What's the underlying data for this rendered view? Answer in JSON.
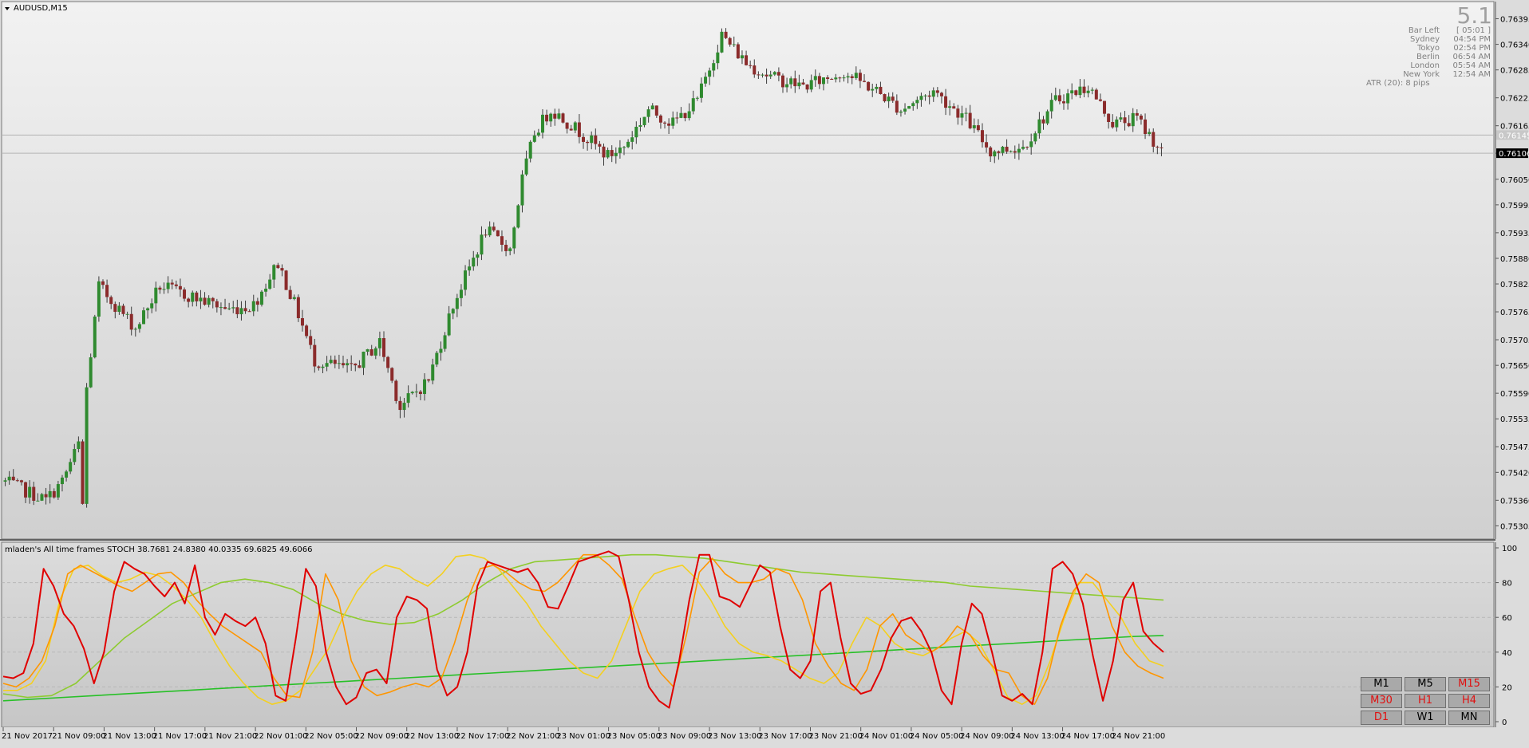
{
  "symbol_title": "AUDUSD,M15",
  "indicator_title": "mladen's  All time frames STOCH 38.7681 24.8380 40.0335 69.6825 49.6066",
  "info_panel": {
    "big_value": "5.1",
    "rows": [
      {
        "label": "Bar Left",
        "value": "[ 05:01 ]"
      },
      {
        "label": "Sydney",
        "value": "04:54 PM"
      },
      {
        "label": "Tokyo",
        "value": "02:54 PM"
      },
      {
        "label": "Berlin",
        "value": "06:54 AM"
      },
      {
        "label": "London",
        "value": "05:54 AM"
      },
      {
        "label": "New York",
        "value": "12:54 AM"
      }
    ],
    "atr": "ATR (20): 8 pips"
  },
  "timeframe_buttons": [
    {
      "label": "M1",
      "active": false
    },
    {
      "label": "M5",
      "active": false
    },
    {
      "label": "M15",
      "active": true
    },
    {
      "label": "M30",
      "active": true
    },
    {
      "label": "H1",
      "active": true
    },
    {
      "label": "H4",
      "active": true
    },
    {
      "label": "D1",
      "active": true
    },
    {
      "label": "W1",
      "active": false
    },
    {
      "label": "MN",
      "active": false
    }
  ],
  "colors": {
    "bull": "#2f8a2f",
    "bear": "#8b2b2b",
    "wick": "#3c3c3c",
    "stoch_m15": "#e00000",
    "stoch_m30": "#ff9600",
    "stoch_h1": "#f4d020",
    "stoch_h4": "#8ecb30",
    "stoch_d1": "#28c028",
    "active_label": "#e01010",
    "inactive_label": "#000000"
  },
  "chart_data": [
    {
      "type": "candlestick",
      "title": "AUDUSD,M15",
      "ylim": [
        0.7528,
        0.76425
      ],
      "price_ticks": [
        "0.76395",
        "0.76340",
        "0.76285",
        "0.76225",
        "0.76165",
        "0.76106",
        "0.76050",
        "0.75995",
        "0.75935",
        "0.75880",
        "0.75825",
        "0.75765",
        "0.75705",
        "0.75650",
        "0.75590",
        "0.75535",
        "0.75475",
        "0.75420",
        "0.75360",
        "0.75305"
      ],
      "current_price": "0.76106",
      "grey_level_label": "0.76145",
      "bar_count": 285,
      "close_anchors": [
        [
          0,
          0.754
        ],
        [
          10,
          0.7536
        ],
        [
          14,
          0.754
        ],
        [
          18,
          0.7548
        ],
        [
          19,
          0.7535
        ],
        [
          20,
          0.756
        ],
        [
          23,
          0.7582
        ],
        [
          28,
          0.7577
        ],
        [
          32,
          0.7573
        ],
        [
          38,
          0.7582
        ],
        [
          45,
          0.758
        ],
        [
          55,
          0.7577
        ],
        [
          61,
          0.7578
        ],
        [
          67,
          0.7587
        ],
        [
          72,
          0.7576
        ],
        [
          76,
          0.7566
        ],
        [
          85,
          0.7564
        ],
        [
          92,
          0.757
        ],
        [
          97,
          0.7556
        ],
        [
          104,
          0.7562
        ],
        [
          110,
          0.7578
        ],
        [
          118,
          0.7594
        ],
        [
          124,
          0.759
        ],
        [
          127,
          0.7605
        ],
        [
          130,
          0.7615
        ],
        [
          134,
          0.762
        ],
        [
          140,
          0.7616
        ],
        [
          148,
          0.761
        ],
        [
          152,
          0.7612
        ],
        [
          158,
          0.762
        ],
        [
          164,
          0.7617
        ],
        [
          170,
          0.7622
        ],
        [
          176,
          0.7636
        ],
        [
          182,
          0.763
        ],
        [
          188,
          0.7627
        ],
        [
          196,
          0.7625
        ],
        [
          206,
          0.7628
        ],
        [
          214,
          0.7624
        ],
        [
          220,
          0.762
        ],
        [
          228,
          0.7624
        ],
        [
          236,
          0.7618
        ],
        [
          242,
          0.7611
        ],
        [
          250,
          0.7612
        ],
        [
          258,
          0.7622
        ],
        [
          266,
          0.7625
        ],
        [
          272,
          0.7617
        ],
        [
          278,
          0.7618
        ],
        [
          284,
          0.7611
        ]
      ],
      "x_labels": [
        "21 Nov 2017",
        "21 Nov 09:00",
        "21 Nov 13:00",
        "21 Nov 17:00",
        "21 Nov 21:00",
        "22 Nov 01:00",
        "22 Nov 05:00",
        "22 Nov 09:00",
        "22 Nov 13:00",
        "22 Nov 17:00",
        "22 Nov 21:00",
        "23 Nov 01:00",
        "23 Nov 05:00",
        "23 Nov 09:00",
        "23 Nov 13:00",
        "23 Nov 17:00",
        "23 Nov 21:00",
        "24 Nov 01:00",
        "24 Nov 05:00",
        "24 Nov 09:00",
        "24 Nov 13:00",
        "24 Nov 17:00",
        "24 Nov 21:00"
      ]
    },
    {
      "type": "line",
      "title": "mladen's  All time frames STOCH 38.7681 24.8380 40.0335 69.6825 49.6066",
      "ylim": [
        0,
        100
      ],
      "y_ticks": [
        100,
        80,
        60,
        40,
        20,
        0
      ],
      "grid": true,
      "series": [
        {
          "key": "m15",
          "values": [
            26,
            25,
            28,
            45,
            88,
            78,
            62,
            55,
            42,
            22,
            40,
            75,
            92,
            88,
            85,
            78,
            72,
            80,
            68,
            90,
            60,
            50,
            62,
            58,
            55,
            60,
            45,
            15,
            12,
            48,
            88,
            78,
            40,
            20,
            10,
            14,
            28,
            30,
            22,
            60,
            72,
            70,
            65,
            30,
            15,
            20,
            40,
            78,
            92,
            90,
            88,
            86,
            88,
            80,
            66,
            65,
            78,
            92,
            94,
            96,
            98,
            95,
            70,
            40,
            20,
            12,
            8,
            35,
            70,
            96,
            96,
            72,
            70,
            66,
            78,
            90,
            86,
            55,
            30,
            25,
            35,
            75,
            80,
            48,
            22,
            16,
            18,
            30,
            48,
            58,
            60,
            52,
            40,
            18,
            10,
            45,
            68,
            62,
            40,
            15,
            12,
            16,
            10,
            40,
            88,
            92,
            85,
            68,
            38,
            12,
            35,
            70,
            80,
            52,
            45,
            40
          ]
        },
        {
          "key": "m30",
          "values": [
            22,
            20,
            25,
            35,
            55,
            85,
            90,
            86,
            82,
            78,
            75,
            80,
            85,
            86,
            80,
            70,
            62,
            55,
            50,
            45,
            40,
            25,
            15,
            14,
            40,
            85,
            70,
            35,
            20,
            15,
            17,
            20,
            22,
            20,
            25,
            45,
            70,
            88,
            90,
            86,
            80,
            76,
            75,
            80,
            88,
            96,
            96,
            90,
            82,
            60,
            40,
            28,
            20,
            50,
            86,
            94,
            85,
            80,
            80,
            82,
            88,
            85,
            70,
            45,
            32,
            22,
            18,
            30,
            55,
            62,
            50,
            45,
            40,
            45,
            55,
            50,
            38,
            30,
            28,
            15,
            10,
            25,
            55,
            75,
            85,
            80,
            55,
            40,
            32,
            28,
            25
          ]
        },
        {
          "key": "h1",
          "values": [
            18,
            18,
            22,
            35,
            70,
            88,
            90,
            84,
            80,
            82,
            86,
            84,
            78,
            70,
            60,
            45,
            32,
            22,
            14,
            10,
            12,
            18,
            30,
            42,
            60,
            75,
            85,
            90,
            88,
            82,
            78,
            85,
            95,
            96,
            94,
            88,
            78,
            68,
            55,
            45,
            35,
            28,
            25,
            35,
            55,
            75,
            85,
            88,
            90,
            82,
            70,
            55,
            45,
            40,
            38,
            35,
            30,
            25,
            22,
            28,
            45,
            60,
            55,
            45,
            40,
            38,
            42,
            48,
            52,
            45,
            30,
            14,
            10,
            15,
            35,
            60,
            80,
            80,
            70,
            60,
            45,
            35,
            32
          ]
        },
        {
          "key": "h4",
          "values": [
            16,
            14,
            15,
            22,
            35,
            48,
            58,
            68,
            74,
            80,
            82,
            80,
            76,
            68,
            62,
            58,
            56,
            57,
            62,
            70,
            80,
            88,
            92,
            93,
            94,
            95,
            96,
            96,
            95,
            94,
            92,
            90,
            88,
            86,
            85,
            84,
            83,
            82,
            81,
            80,
            78,
            77,
            76,
            75,
            74,
            73,
            72,
            71,
            70
          ]
        },
        {
          "key": "d1",
          "values": [
            12,
            13,
            14,
            15,
            16,
            17,
            18,
            19,
            20,
            21,
            22,
            23,
            24,
            25,
            26,
            27,
            28,
            29,
            30,
            31,
            32,
            33,
            34,
            35,
            36,
            37,
            38,
            39,
            40,
            41,
            42,
            43,
            44,
            45,
            46,
            47,
            48,
            49,
            49.6
          ]
        }
      ]
    }
  ]
}
